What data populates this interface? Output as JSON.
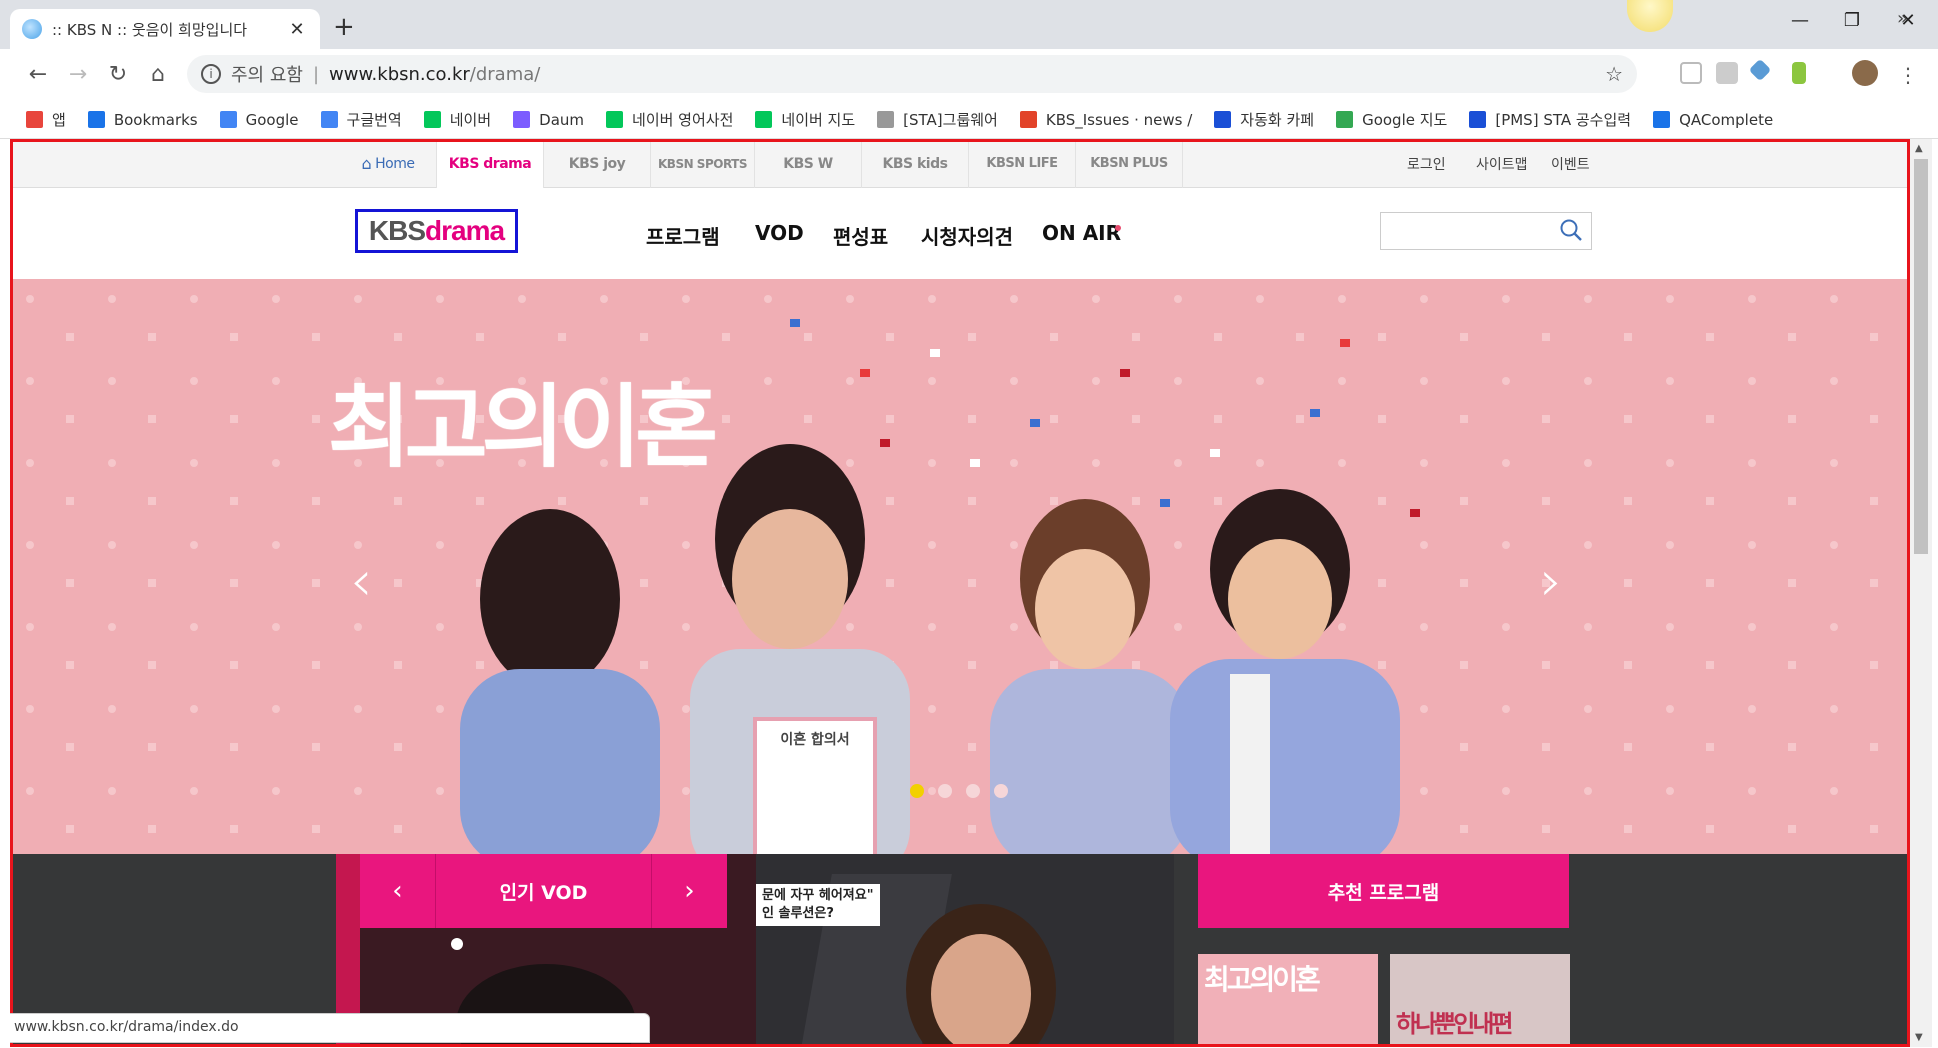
{
  "browser": {
    "tab_title": ":: KBS N :: 웃음이 희망입니다",
    "url_security": "주의 요함",
    "url_host": "www.kbsn.co.kr",
    "url_path": "/drama/",
    "status_url": "www.kbsn.co.kr/drama/index.do"
  },
  "bookmarks": [
    {
      "label": "앱",
      "icon": "apps-grid-icon",
      "color": "#e8453c"
    },
    {
      "label": "Bookmarks",
      "icon": "star-icon",
      "color": "#1a73e8"
    },
    {
      "label": "Google",
      "icon": "google-g-icon",
      "color": "#4285f4"
    },
    {
      "label": "구글번역",
      "icon": "translate-icon",
      "color": "#4285f4"
    },
    {
      "label": "네이버",
      "icon": "naver-n-icon",
      "color": "#03c75a"
    },
    {
      "label": "Daum",
      "icon": "daum-d-icon",
      "color": "#7c5cff"
    },
    {
      "label": "네이버 영어사전",
      "icon": "dict-icon",
      "color": "#03c75a"
    },
    {
      "label": "네이버 지도",
      "icon": "naver-n-icon",
      "color": "#03c75a"
    },
    {
      "label": "[STA]그룹웨어",
      "icon": "page-icon",
      "color": "#999999"
    },
    {
      "label": "KBS_Issues · news /",
      "icon": "gitlab-fox-icon",
      "color": "#e24329"
    },
    {
      "label": "자동화 카페",
      "icon": "sta-icon",
      "color": "#1a4fd6"
    },
    {
      "label": "Google 지도",
      "icon": "maps-pin-icon",
      "color": "#34a853"
    },
    {
      "label": "[PMS] STA 공수입력",
      "icon": "pms-icon",
      "color": "#1a4fd6"
    },
    {
      "label": "QAComplete",
      "icon": "qacomplete-icon",
      "color": "#1a73e8"
    }
  ],
  "site": {
    "channels": [
      {
        "label": "Home",
        "icon": "home-icon"
      },
      {
        "label": "KBS drama"
      },
      {
        "label": "KBS joy"
      },
      {
        "label": "KBSN SPORTS"
      },
      {
        "label": "KBS W"
      },
      {
        "label": "KBS kids"
      },
      {
        "label": "KBSN LIFE"
      },
      {
        "label": "KBSN PLUS"
      }
    ],
    "util": [
      "로그인",
      "사이트맵",
      "이벤트"
    ],
    "logo_kbs": "KBS",
    "logo_drama": "drama",
    "menu": [
      "프로그램",
      "VOD",
      "편성표",
      "시청자의견",
      "ON AIR"
    ],
    "search_placeholder": "",
    "hero_title": "최고의이혼",
    "hero_prop": "이혼 합의서",
    "carousel_active_index": 1,
    "carousel_count": 4,
    "vod_label": "인기 VOD",
    "vod_caption_line1": "문에 자꾸 헤어져요\"",
    "vod_caption_line2": "인 솔루션은?",
    "recommend_label": "추천 프로그램",
    "rec_thumbs": [
      "최고의이혼",
      "하나뿐인내편"
    ],
    "colors": {
      "accent": "#e9167e",
      "hero_bg": "#f0aeb4",
      "frame": "#e8141c"
    }
  }
}
